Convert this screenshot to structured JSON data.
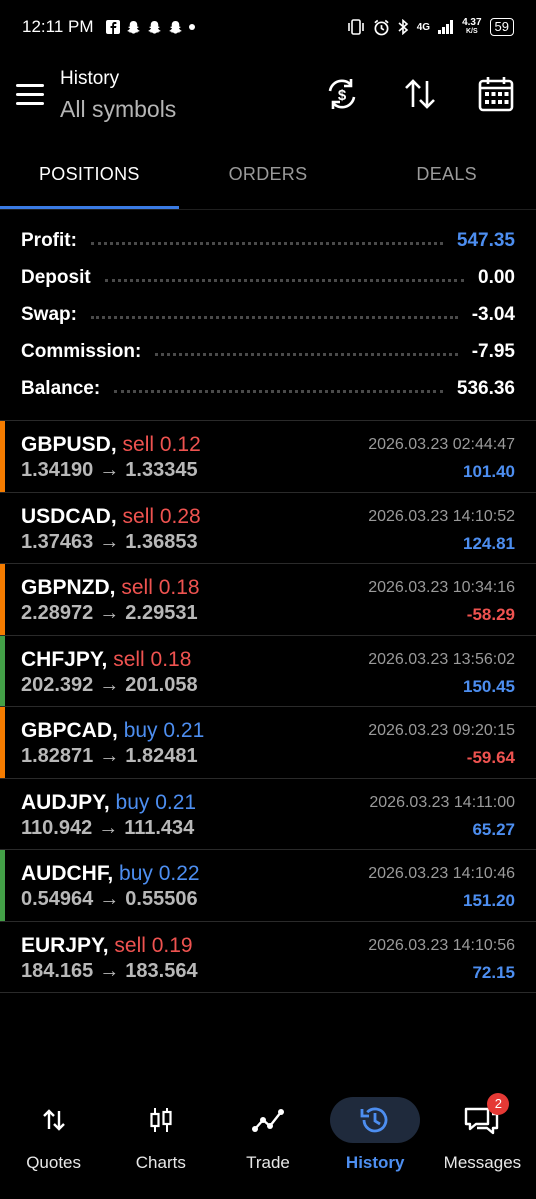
{
  "status_bar": {
    "time": "12:11 PM",
    "network": "4G",
    "speed": "4.37",
    "speed_unit": "K/S",
    "battery": "59"
  },
  "header": {
    "title": "History",
    "subtitle": "All symbols"
  },
  "tabs": [
    {
      "label": "POSITIONS",
      "active": true
    },
    {
      "label": "ORDERS",
      "active": false
    },
    {
      "label": "DEALS",
      "active": false
    }
  ],
  "summary": [
    {
      "label": "Profit:",
      "value": "547.35"
    },
    {
      "label": "Deposit",
      "value": "0.00"
    },
    {
      "label": "Swap:",
      "value": "-3.04"
    },
    {
      "label": "Commission:",
      "value": "-7.95"
    },
    {
      "label": "Balance:",
      "value": "536.36"
    }
  ],
  "positions": [
    {
      "symbol": "GBPUSD,",
      "side": "sell 0.12",
      "open": "1.34190",
      "close": "1.33345",
      "date": "2026.03.23 02:44:47",
      "profit": "101.40",
      "bar_color": "#f57c00"
    },
    {
      "symbol": "USDCAD,",
      "side": "sell 0.28",
      "open": "1.37463",
      "close": "1.36853",
      "date": "2026.03.23 14:10:52",
      "profit": "124.81",
      "bar_color": ""
    },
    {
      "symbol": "GBPNZD,",
      "side": "sell 0.18",
      "open": "2.28972",
      "close": "2.29531",
      "date": "2026.03.23 10:34:16",
      "profit": "-58.29",
      "bar_color": "#f57c00"
    },
    {
      "symbol": "CHFJPY,",
      "side": "sell 0.18",
      "open": "202.392",
      "close": "201.058",
      "date": "2026.03.23 13:56:02",
      "profit": "150.45",
      "bar_color": "#43a047"
    },
    {
      "symbol": "GBPCAD,",
      "side": "buy 0.21",
      "open": "1.82871",
      "close": "1.82481",
      "date": "2026.03.23 09:20:15",
      "profit": "-59.64",
      "bar_color": "#f57c00"
    },
    {
      "symbol": "AUDJPY,",
      "side": "buy 0.21",
      "open": "110.942",
      "close": "111.434",
      "date": "2026.03.23 14:11:00",
      "profit": "65.27",
      "bar_color": ""
    },
    {
      "symbol": "AUDCHF,",
      "side": "buy 0.22",
      "open": "0.54964",
      "close": "0.55506",
      "date": "2026.03.23 14:10:46",
      "profit": "151.20",
      "bar_color": "#43a047"
    },
    {
      "symbol": "EURJPY,",
      "side": "sell 0.19",
      "open": "184.165",
      "close": "183.564",
      "date": "2026.03.23 14:10:56",
      "profit": "72.15",
      "bar_color": ""
    }
  ],
  "price_arrow": "→",
  "bottom_nav": [
    {
      "label": "Quotes",
      "icon": "quotes-arrows-icon",
      "active": false
    },
    {
      "label": "Charts",
      "icon": "candlestick-icon",
      "active": false
    },
    {
      "label": "Trade",
      "icon": "trend-line-icon",
      "active": false
    },
    {
      "label": "History",
      "icon": "history-clock-icon",
      "active": true
    },
    {
      "label": "Messages",
      "icon": "chat-icon",
      "active": false,
      "badge": "2"
    }
  ],
  "colors": {
    "accent": "#4d8ef0",
    "sell": "#ef5350",
    "buy": "#4d8ef0",
    "background": "#000000"
  }
}
